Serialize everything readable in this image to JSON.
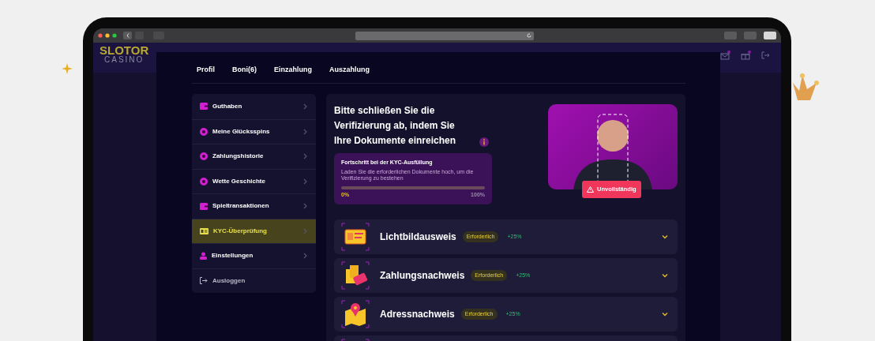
{
  "site_header": {
    "logo_text": "SLOTOR",
    "logo_subtext": "CASINO"
  },
  "modal": {
    "tabs": [
      {
        "label": "Profil"
      },
      {
        "label": "Boni(6)"
      },
      {
        "label": "Einzahlung"
      },
      {
        "label": "Auszahlung"
      }
    ],
    "sidebar": {
      "items": [
        {
          "label": "Guthaben",
          "kind": "nav",
          "selected": false
        },
        {
          "label": "Meine Glücksspins",
          "kind": "nav",
          "selected": false
        },
        {
          "label": "Zahlungshistorie",
          "kind": "nav",
          "selected": false
        },
        {
          "label": "Wette Geschichte",
          "kind": "nav",
          "selected": false
        },
        {
          "label": "Spieltransaktionen",
          "kind": "nav",
          "selected": false
        },
        {
          "label": "KYC-Überprüfung",
          "kind": "nav",
          "selected": true
        },
        {
          "label": "Einstellungen",
          "kind": "nav",
          "selected": false
        },
        {
          "label": "Ausloggen",
          "kind": "logout",
          "selected": false
        }
      ]
    },
    "kyc": {
      "heading": "Bitte schließen Sie die Verifizierung ab, indem Sie Ihre Dokumente einreichen",
      "progress": {
        "title": "Fortschritt bei der KYC-Ausfüllung",
        "description": "Laden Sie die erforderlichen Dokumente hoch, um die Verifizierung zu bestehen",
        "level": 0,
        "start_label": "0%",
        "end_label": "100%"
      },
      "status_badge": "Unvollständig",
      "documents": [
        {
          "kind": "full",
          "title": "Lichtbildausweis",
          "badge": "Erforderlich",
          "bonus": "+25%"
        },
        {
          "kind": "full",
          "title": "Zahlungsnachweis",
          "badge": "Erforderlich",
          "bonus": "+25%"
        },
        {
          "kind": "full",
          "title": "Adressnachweis",
          "badge": "Erforderlich",
          "bonus": "+25%"
        },
        {
          "kind": "cut"
        }
      ]
    }
  }
}
